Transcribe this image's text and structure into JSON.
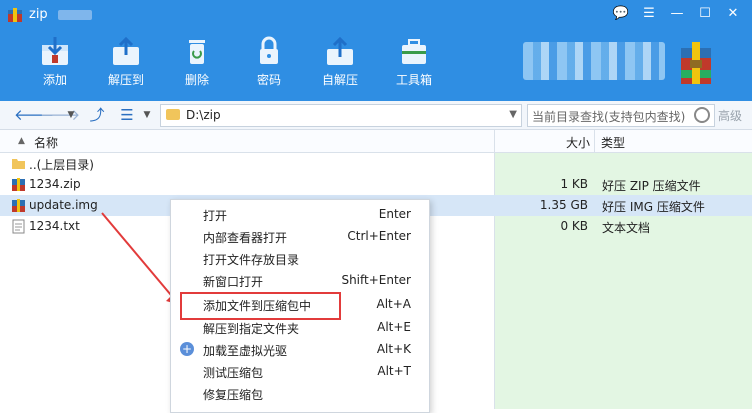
{
  "window": {
    "title": "zip",
    "controls": [
      "feedback-icon",
      "menu-icon",
      "minimize-icon",
      "maximize-icon",
      "close-icon"
    ]
  },
  "toolbar": {
    "items": [
      {
        "label": "添加",
        "icon": "add-archive-icon"
      },
      {
        "label": "解压到",
        "icon": "extract-to-icon"
      },
      {
        "label": "删除",
        "icon": "delete-icon"
      },
      {
        "label": "密码",
        "icon": "lock-icon"
      },
      {
        "label": "自解压",
        "icon": "self-extract-icon"
      },
      {
        "label": "工具箱",
        "icon": "toolbox-icon"
      }
    ]
  },
  "addressbar": {
    "path": "D:\\zip",
    "search_placeholder": "当前目录查找(支持包内查找)",
    "advanced_label": "高级"
  },
  "columns": {
    "name": "名称",
    "size": "大小",
    "type": "类型"
  },
  "files": [
    {
      "name": "..(上层目录)",
      "size": "",
      "type": "",
      "icon": "folder-icon"
    },
    {
      "name": "1234.zip",
      "size": "1 KB",
      "type": "好压 ZIP 压缩文件",
      "icon": "archive-icon"
    },
    {
      "name": "update.img",
      "size": "1.35 GB",
      "type": "好压 IMG 压缩文件",
      "icon": "archive-icon"
    },
    {
      "name": "1234.txt",
      "size": "0 KB",
      "type": "文本文档",
      "icon": "text-file-icon"
    }
  ],
  "context_menu": [
    {
      "label": "打开",
      "shortcut": "Enter"
    },
    {
      "label": "内部查看器打开",
      "shortcut": "Ctrl+Enter"
    },
    {
      "label": "打开文件存放目录",
      "shortcut": ""
    },
    {
      "label": "新窗口打开",
      "shortcut": "Shift+Enter"
    },
    {
      "label": "添加文件到压缩包中",
      "shortcut": "Alt+A"
    },
    {
      "label": "解压到指定文件夹",
      "shortcut": "Alt+E"
    },
    {
      "label": "加载至虚拟光驱",
      "shortcut": "Alt+K"
    },
    {
      "label": "测试压缩包",
      "shortcut": "Alt+T"
    },
    {
      "label": "修复压缩包",
      "shortcut": ""
    }
  ],
  "colors": {
    "header": "#2f8ee3",
    "selection": "#d6e6f7",
    "green_panel": "#e3f6e3",
    "annotation": "#e23b3b"
  }
}
